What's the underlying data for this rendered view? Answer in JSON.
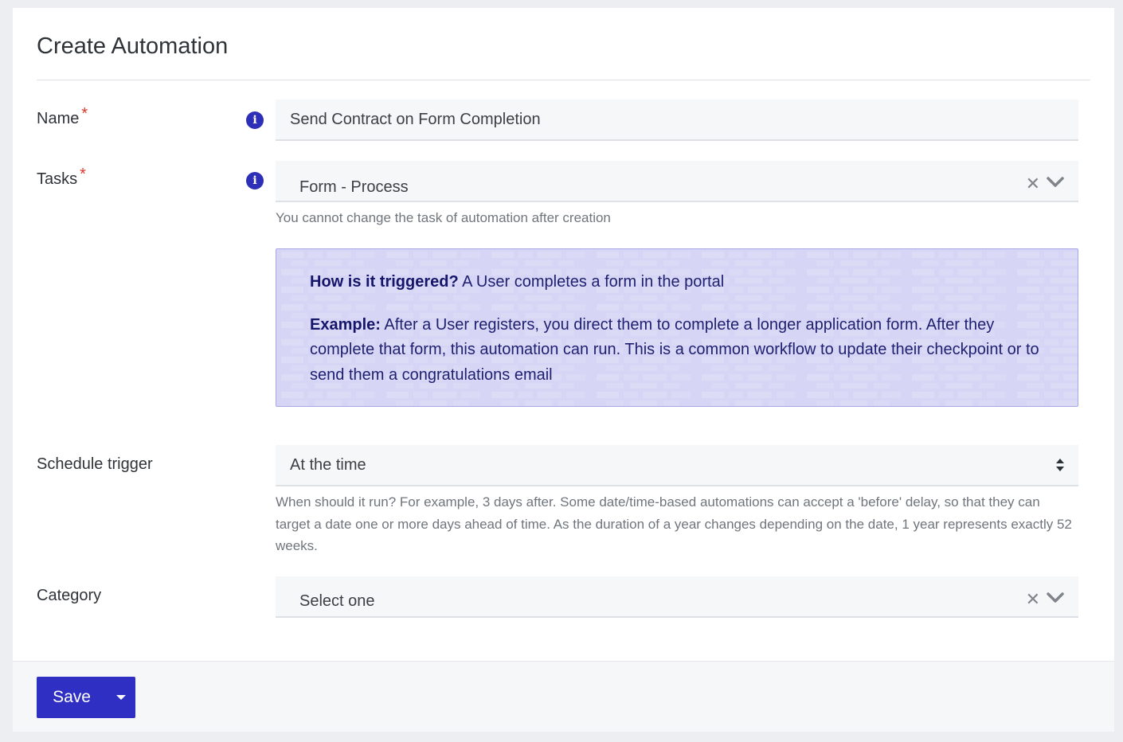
{
  "form": {
    "title": "Create Automation",
    "name": {
      "label": "Name",
      "required_mark": "*",
      "value": "Send Contract on Form Completion"
    },
    "tasks": {
      "label": "Tasks",
      "required_mark": "*",
      "selected": "Form - Process",
      "help": "You cannot change the task of automation after creation"
    },
    "info_box": {
      "trigger_heading": "How is it triggered?",
      "trigger_text": "A User completes a form in the portal",
      "example_heading": "Example:",
      "example_text": "After a User registers, you direct them to complete a longer application form. After they complete that form, this automation can run. This is a common workflow to update their checkpoint or to send them a congratulations email"
    },
    "schedule_trigger": {
      "label": "Schedule trigger",
      "selected": "At the time",
      "help": "When should it run? For example, 3 days after. Some date/time-based automations can accept a 'before' delay, so that they can target a date one or more days ahead of time. As the duration of a year changes depending on the date, 1 year represents exactly 52 weeks."
    },
    "category": {
      "label": "Category",
      "placeholder": "Select one"
    }
  },
  "footer": {
    "save_label": "Save"
  },
  "icons": {
    "info": "info-icon",
    "clear": "close-icon",
    "dropdown": "chevron-down-icon",
    "stepper": "sort-arrows-icon",
    "save_menu": "caret-down-icon"
  },
  "colors": {
    "primary": "#2f2fc4",
    "info_icon": "#2d2fb8",
    "required": "#d9382b",
    "info_box_bg": "#d6d5f5",
    "info_box_text": "#1f1f70"
  }
}
